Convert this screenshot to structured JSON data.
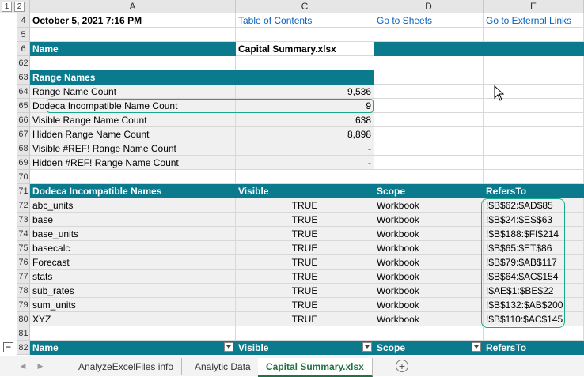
{
  "outline_levels": [
    "1",
    "2"
  ],
  "columns": [
    "A",
    "C",
    "D",
    "E"
  ],
  "rows": [
    {
      "n": "4",
      "a": "October 5, 2021 7:16 PM",
      "c": "Table of Contents",
      "d": "Go to Sheets",
      "e": "Go to External Links"
    },
    {
      "n": "5"
    },
    {
      "n": "6",
      "a": "Name",
      "c": "Capital Summary.xlsx"
    },
    {
      "n": "62"
    },
    {
      "n": "63",
      "a": "Range Names"
    },
    {
      "n": "64",
      "a": "Range Name Count",
      "c": "9,536"
    },
    {
      "n": "65",
      "a": "Dodeca Incompatible Name Count",
      "c": "9"
    },
    {
      "n": "66",
      "a": "Visible Range Name Count",
      "c": "638"
    },
    {
      "n": "67",
      "a": "Hidden Range Name Count",
      "c": "8,898"
    },
    {
      "n": "68",
      "a": "Visible #REF! Range Name Count",
      "c": "-"
    },
    {
      "n": "69",
      "a": "Hidden #REF! Range Name Count",
      "c": "-"
    },
    {
      "n": "70"
    },
    {
      "n": "71",
      "a": "Dodeca Incompatible Names",
      "c": "Visible",
      "d": "Scope",
      "e": "RefersTo"
    },
    {
      "n": "72",
      "a": "abc_units",
      "c": "TRUE",
      "d": "Workbook",
      "e": "!$B$62:$AD$85"
    },
    {
      "n": "73",
      "a": "base",
      "c": "TRUE",
      "d": "Workbook",
      "e": "!$B$24:$ES$63"
    },
    {
      "n": "74",
      "a": "base_units",
      "c": "TRUE",
      "d": "Workbook",
      "e": "!$B$188:$FI$214"
    },
    {
      "n": "75",
      "a": "basecalc",
      "c": "TRUE",
      "d": "Workbook",
      "e": "!$B$65:$ET$86"
    },
    {
      "n": "76",
      "a": "Forecast",
      "c": "TRUE",
      "d": "Workbook",
      "e": "!$B$79:$AB$117"
    },
    {
      "n": "77",
      "a": "stats",
      "c": "TRUE",
      "d": "Workbook",
      "e": "!$B$64:$AC$154"
    },
    {
      "n": "78",
      "a": "sub_rates",
      "c": "TRUE",
      "d": "Workbook",
      "e": "!$AE$1:$BE$22"
    },
    {
      "n": "79",
      "a": "sum_units",
      "c": "TRUE",
      "d": "Workbook",
      "e": "!$B$132:$AB$200"
    },
    {
      "n": "80",
      "a": "XYZ",
      "c": "TRUE",
      "d": "Workbook",
      "e": "!$B$110:$AC$145"
    },
    {
      "n": "81"
    },
    {
      "n": "82",
      "a": "Name",
      "c": "Visible",
      "d": "Scope",
      "e": "RefersTo"
    }
  ],
  "outline_collapse": "−",
  "tabs": [
    "AnalyzeExcelFiles info",
    "Analytic Data",
    "Capital Summary.xlsx"
  ],
  "active_tab": "Capital Summary.xlsx",
  "nav_prev": "◀",
  "nav_next": "▶",
  "add_sheet": "+",
  "accent_color": "#0a7a8c",
  "highlight_color": "#1aa88a"
}
